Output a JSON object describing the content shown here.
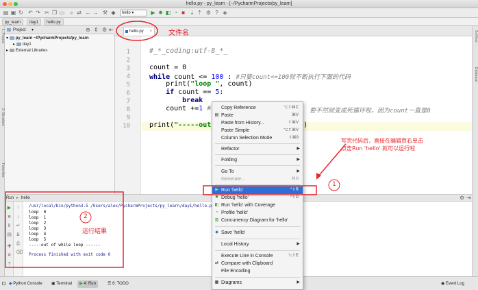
{
  "window": {
    "title": "hello.py - py_learn - [~/PycharmProjects/py_learn]"
  },
  "toolbar": {
    "run_config": "hello"
  },
  "breadcrumb": [
    "py_learn",
    "day1",
    "hello.py"
  ],
  "project_panel": {
    "title": "Project",
    "tree": [
      {
        "label": "py_learn ~/PycharmProjects/py_learn"
      },
      {
        "label": "day1"
      },
      {
        "label": "External Libraries"
      }
    ]
  },
  "editor": {
    "tab": "hello.py",
    "line_numbers": [
      "1",
      "2",
      "3",
      "4",
      "5",
      "6",
      "7",
      "8",
      "9",
      "10"
    ],
    "code": {
      "l1": "#_*_coding:utf-8_*_",
      "l3": "count = 0",
      "l4_kw": "while",
      "l4_a": " count <= ",
      "l4_num": "100",
      "l4_b": " : ",
      "l4_cm": "#只要count<=100就不断执行下面的代码",
      "l5_a": "    print(",
      "l5_str": "\"loop \"",
      "l5_b": ", count)",
      "l6_kw": "    if",
      "l6_a": " count == ",
      "l6_num": "5",
      "l6_b": ":",
      "l7_kw": "        break",
      "l8_a": "    count +=",
      "l8_num": "1",
      "l8_cm": " #",
      "l8_tail": "要不然就变成死循环啦，因为count一直是0",
      "l10_a": "print(",
      "l10_str": "\"-----out",
      "l10_b": ")"
    }
  },
  "run_panel": {
    "title": "Run",
    "config": "hello",
    "output": [
      "/usr/local/bin/python3.5 /Users/alex/PycharmProjects/py_learn/day1/hello.p",
      "loop  0",
      "loop  1",
      "loop  2",
      "loop  3",
      "loop  4",
      "loop  5",
      "-----out of while loop ------",
      "",
      "Process finished with exit code 0"
    ]
  },
  "bottom_tabs": {
    "python_console": "Python Console",
    "terminal": "Terminal",
    "run": "4: Run",
    "todo": "6: TODO",
    "event_log": "Event Log"
  },
  "side_labels": {
    "left_top": "1: Project",
    "left_mid": "2: Structure",
    "left_low": "Favorites",
    "right_top": "SciView",
    "right_mid": "Database"
  },
  "context_menu": {
    "items": [
      {
        "label": "Copy Reference",
        "shortcut": "⌥⇧⌘C"
      },
      {
        "label": "Paste",
        "shortcut": "⌘V"
      },
      {
        "label": "Paste from History...",
        "shortcut": "⇧⌘V"
      },
      {
        "label": "Paste Simple",
        "shortcut": "⌥⇧⌘V"
      },
      {
        "label": "Column Selection Mode",
        "shortcut": "⇧⌘8"
      },
      {
        "label": "Refactor"
      },
      {
        "label": "Folding"
      },
      {
        "label": "Go To"
      },
      {
        "label": "Generate...",
        "shortcut": "⌘N"
      },
      {
        "label": "Run 'hello'",
        "shortcut": "^⇧R"
      },
      {
        "label": "Debug 'hello'",
        "shortcut": "^⇧D"
      },
      {
        "label": "Run 'hello' with Coverage"
      },
      {
        "label": "Profile 'hello'"
      },
      {
        "label": "Concurrency Diagram for  'hello'"
      },
      {
        "label": "Save 'hello'"
      },
      {
        "label": "Local History"
      },
      {
        "label": "Execute Line in Console",
        "shortcut": "⌥⇧E"
      },
      {
        "label": "Compare with Clipboard"
      },
      {
        "label": "File Encoding"
      },
      {
        "label": "Diagrams"
      }
    ]
  },
  "annotations": {
    "filename": "文件名",
    "instruction_line1": "写完代码后，直接在编辑页右单击",
    "instruction_line2": "点击Run  'hello' 就可以运行啦",
    "marker1": "1",
    "marker2": "2",
    "result": "运行结果"
  },
  "colors": {
    "accent": "#2b6fd7",
    "annotation": "#e8252b",
    "keyword": "#000080",
    "number": "#0000ff",
    "string": "#008000",
    "comment": "#808080"
  }
}
